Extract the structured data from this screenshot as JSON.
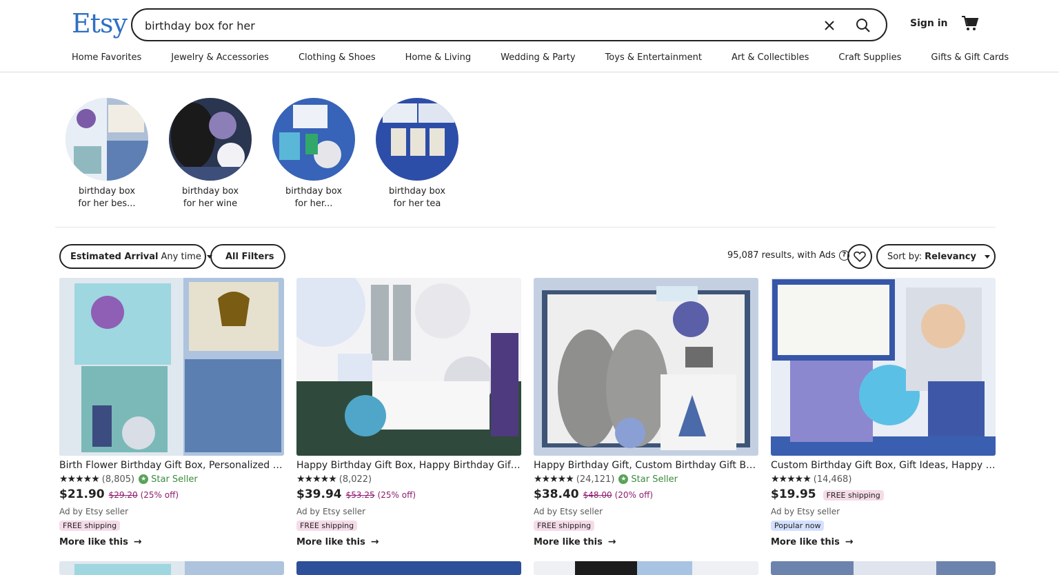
{
  "header": {
    "logo": "Etsy",
    "search_value": "birthday box for her",
    "sign_in": "Sign in"
  },
  "nav": [
    "Home Favorites",
    "Jewelry & Accessories",
    "Clothing & Shoes",
    "Home & Living",
    "Wedding & Party",
    "Toys & Entertainment",
    "Art & Collectibles",
    "Craft Supplies",
    "Gifts & Gift Cards"
  ],
  "related": [
    {
      "line1": "birthday box",
      "line2": "for her bes..."
    },
    {
      "line1": "birthday box",
      "line2": "for her wine"
    },
    {
      "line1": "birthday box",
      "line2": "for her..."
    },
    {
      "line1": "birthday box",
      "line2": "for her tea"
    }
  ],
  "filters": {
    "arrival_label": "Estimated Arrival",
    "arrival_value": "Any time",
    "all_filters": "All Filters",
    "results": "95,087 results, with Ads",
    "sort_label": "Sort by:",
    "sort_value": "Relevancy"
  },
  "products": [
    {
      "title": "Birth Flower Birthday Gift Box, Personalized birthday gift box for her",
      "stars": "★★★★★",
      "reviews": "(8,805)",
      "star_seller": "Star Seller",
      "price": "$21.90",
      "original": "$29.20",
      "discount": "(25% off)",
      "ad": "Ad by Etsy seller",
      "badge": "FREE shipping",
      "more": "More like this"
    },
    {
      "title": "Happy Birthday Gift Box, Happy Birthday Gift, Spa Gift Box for Her",
      "stars": "★★★★★",
      "reviews": "(8,022)",
      "star_seller": "",
      "price": "$39.94",
      "original": "$53.25",
      "discount": "(25% off)",
      "ad": "Ad by Etsy seller",
      "badge": "FREE shipping",
      "more": "More like this"
    },
    {
      "title": "Happy Birthday Gift, Custom Birthday Gift Box, Birthday Gift for Her",
      "stars": "★★★★★",
      "reviews": "(24,121)",
      "star_seller": "Star Seller",
      "price": "$38.40",
      "original": "$48.00",
      "discount": "(20% off)",
      "ad": "Ad by Etsy seller",
      "badge": "FREE shipping",
      "more": "More like this"
    },
    {
      "title": "Custom Birthday Gift Box, Gift Ideas, Happy Birthday Box for Sister",
      "stars": "★★★★★",
      "reviews": "(14,468)",
      "star_seller": "",
      "price": "$19.95",
      "inline_badge": "FREE shipping",
      "ad": "Ad by Etsy seller",
      "badge": "Popular now",
      "more": "More like this"
    }
  ],
  "colors": {
    "brand": "#2f6fc4",
    "sale": "#8e1a6e",
    "star_seller": "#3b8a3e",
    "ship_badge": "#f5dbe8",
    "popular_badge": "#d3e0ff"
  }
}
